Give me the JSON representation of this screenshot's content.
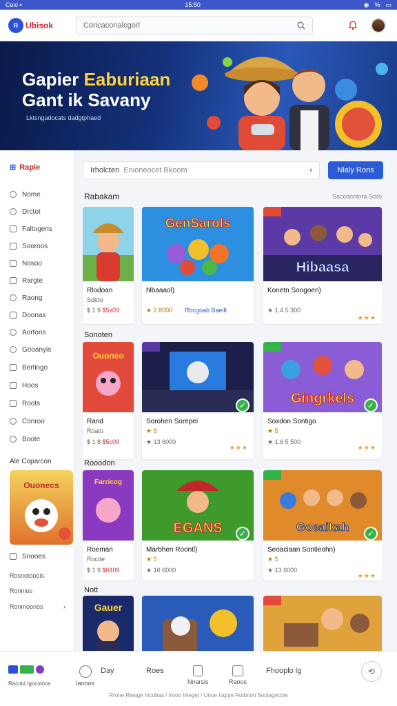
{
  "status": {
    "time": "15:50",
    "carrier": "Cexi ▪",
    "battery": "%"
  },
  "header": {
    "logo_badge": "R",
    "logo_text": "Ubisok",
    "search_placeholder": "Coricaconalcgorl"
  },
  "hero": {
    "title_part1": "Gapier ",
    "title_part2": "Eaburiaan",
    "title_line2": "Gant ik Savany",
    "subtitle": "Lktsngadocats dadgtphaed"
  },
  "sidebar": {
    "header": "Rapie",
    "items": [
      "Nome",
      "Drctot",
      "Faltogeris",
      "Sooroos",
      "Nosoo",
      "Rargte",
      "Raong",
      "Doonas",
      "Aortons",
      "Gooanyis",
      "Bertingo",
      "Hoos",
      "Roots",
      "Conroo",
      "Boote"
    ],
    "section": "Ale Coparcon",
    "promo_label": "Snooes",
    "foot1": "Rosnotooois",
    "foot2": "Ronnios",
    "foot3": "Ronmoonos"
  },
  "content": {
    "filter_label": "Irholcten",
    "filter_hint": "Enioneocet Bkoom",
    "cta_label": "Nlaly Rons",
    "section1": "Rabakam",
    "section1_right": "Sacconntora Soro",
    "section2": "Sonoten",
    "section3": "Rooodon",
    "section4": "Nott"
  },
  "cards": [
    {
      "title": "Rlodoan",
      "meta": "Sdtdo",
      "price1": "$ 1 9 ",
      "price2": "$5s09",
      "thumb_text": ""
    },
    {
      "title": "hlbaaaol)",
      "meta": "",
      "price1": "★ 2 8000",
      "price2": "",
      "extra": "Rbcgoab Baeilt",
      "thumb_text": "GenSarols"
    },
    {
      "title": "Konetn Soogoen)",
      "meta": "",
      "price1": "★ 1.4 5 300",
      "price2": "",
      "thumb_text": "Hibaasa",
      "dots": "★★★"
    },
    {
      "title": "Rand",
      "meta": "Roato",
      "price1": "$ 1 8 ",
      "price2": "$5c09",
      "thumb_text": "Ouoneo"
    },
    {
      "title": "Sorohen Sorepei",
      "meta": "★ 5 ",
      "price1": "★ 13 6000",
      "price2": "",
      "thumb_text": "",
      "dots": "★★★"
    },
    {
      "title": "Soxdon Sontigo",
      "meta": "★ 5 ",
      "price1": "★ 1.6 5 500",
      "price2": "",
      "thumb_text": "Gingrkels",
      "dots": "★★★"
    },
    {
      "title": "Roeman",
      "meta": "Rocde",
      "price1": "$ 1 9 ",
      "price2": "$0409",
      "thumb_text": "Farricog"
    },
    {
      "title": "Marbhen Roontl)",
      "meta": "★ 5 ",
      "price1": "★ 16 6000",
      "price2": "",
      "thumb_text": "EGANS"
    },
    {
      "title": "Seoaciaan Sontieohn)",
      "meta": "★ 5 ",
      "price1": "★ 13 6000",
      "price2": "",
      "thumb_text": "Goeaikah",
      "dots": "★★★"
    },
    {
      "title": "",
      "meta": "",
      "price1": "",
      "price2": "",
      "thumb_text": "Gauer"
    },
    {
      "title": "",
      "meta": "",
      "price1": "",
      "price2": "",
      "thumb_text": ""
    },
    {
      "title": "",
      "meta": "",
      "price1": "",
      "price2": "",
      "thumb_text": ""
    }
  ],
  "bottomnav": {
    "left_label": "Racoid Igocoloos",
    "items": [
      {
        "label": "Iaooos"
      },
      {
        "label": "Nnarsis"
      },
      {
        "label": "Raoos"
      }
    ],
    "text1": "Day",
    "text2": "Roes",
    "text3": "Fhooplo lg",
    "footer": "Rrone Rleage Incobas / Irooo Inleget / Unoe Iogoje Rotbnon Soolagecoie"
  }
}
